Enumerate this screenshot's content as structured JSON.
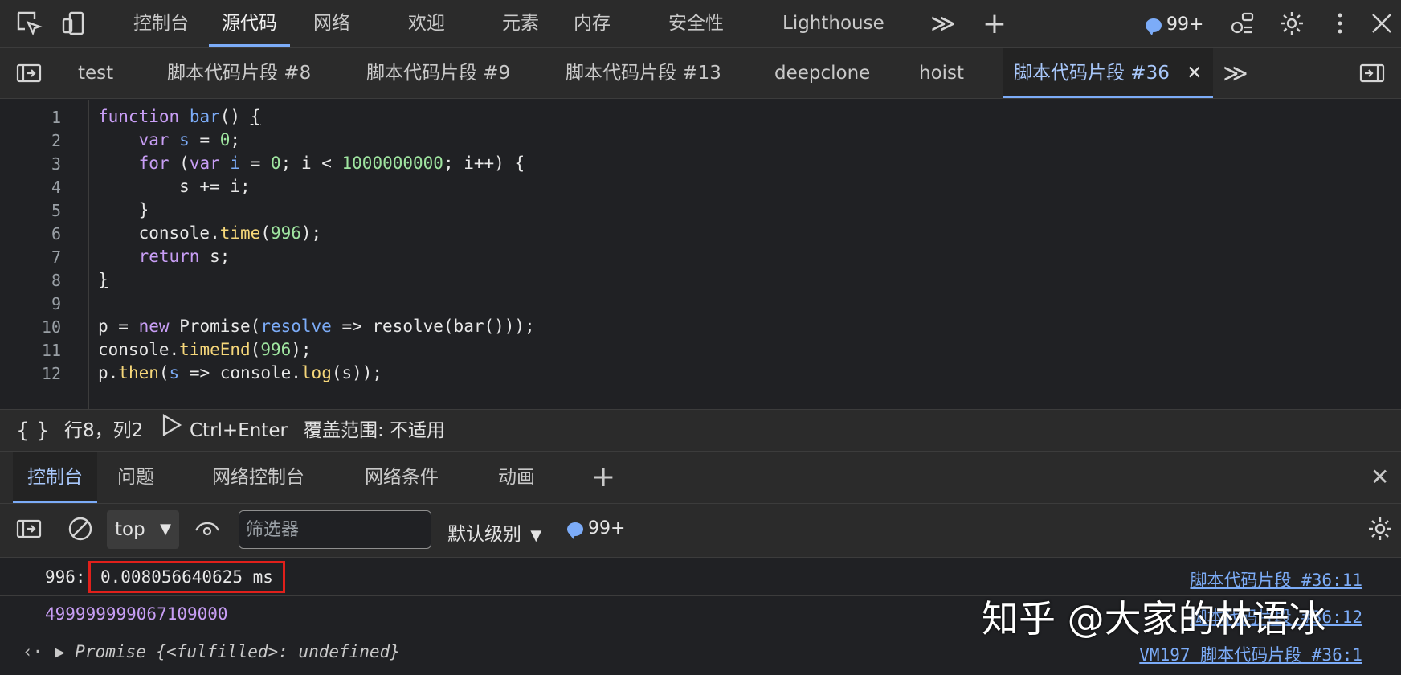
{
  "top_toolbar": {
    "tabs": [
      "控制台",
      "源代码",
      "网络",
      "欢迎",
      "元素",
      "内存",
      "安全性",
      "Lighthouse"
    ],
    "active_tab": "源代码",
    "more_glyph": "≫",
    "add_glyph": "+",
    "issues_count": "99+",
    "icons": [
      "inspect-icon",
      "device-toolbar-icon",
      "chevron-more-icon",
      "plus-icon",
      "issues-icon",
      "customize-icon",
      "settings-icon",
      "kebab-menu-icon",
      "close-icon"
    ]
  },
  "file_tabs": {
    "items": [
      "test",
      "脚本代码片段 #8",
      "脚本代码片段 #9",
      "脚本代码片段 #13",
      "deepclone",
      "hoist",
      "脚本代码片段 #36"
    ],
    "active": "脚本代码片段 #36",
    "close_glyph": "✕",
    "more_glyph": "≫"
  },
  "editor": {
    "line_numbers": [
      "1",
      "2",
      "3",
      "4",
      "5",
      "6",
      "7",
      "8",
      "9",
      "10",
      "11",
      "12"
    ]
  },
  "status_bar": {
    "braces": "{ }",
    "position": "行8，列2",
    "run_shortcut": "Ctrl+Enter",
    "coverage": "覆盖范围: 不适用"
  },
  "drawer": {
    "tabs": [
      "控制台",
      "问题",
      "网络控制台",
      "网络条件",
      "动画"
    ],
    "active": "控制台",
    "add_glyph": "+",
    "close_glyph": "✕"
  },
  "console_toolbar": {
    "context": "top",
    "filter_placeholder": "筛选器",
    "level": "默认级别",
    "issues_count": "99+"
  },
  "console": {
    "rows": [
      {
        "label": "996:",
        "value": "0.008056640625 ms",
        "source": "脚本代码片段 #36:11"
      },
      {
        "value": "499999999067109000",
        "source": "脚本代码片段 #36:12"
      },
      {
        "arrow": "‹·",
        "value": "▶ Promise {<fulfilled>: undefined}",
        "source": "VM197 脚本代码片段 #36:1"
      }
    ],
    "highlight_color": "#e0201b"
  },
  "watermark": "知乎 @大家的林语冰",
  "colors": {
    "accent": "#7cacf8",
    "keyword": "#c89ef5",
    "number": "#9fe5a0",
    "method": "#f6d77a",
    "background": "#202124"
  }
}
